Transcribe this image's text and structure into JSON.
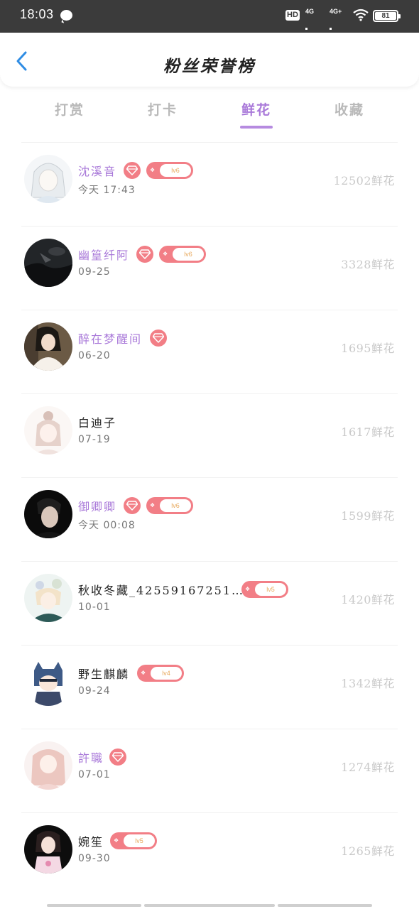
{
  "status_bar": {
    "time": "18:03",
    "hd_label": "HD",
    "sim1_label": "4G",
    "sim2_label": "4G+",
    "battery": "81"
  },
  "header": {
    "title": "粉丝荣誉榜",
    "back_icon": "chevron-left-icon"
  },
  "tabs": [
    {
      "label": "打赏",
      "active": false
    },
    {
      "label": "打卡",
      "active": false
    },
    {
      "label": "鲜花",
      "active": true
    },
    {
      "label": "收藏",
      "active": false
    }
  ],
  "colors": {
    "accent_purple": "#a979d9",
    "badge_pink": "#f27e86",
    "score_gray": "#c9c9c9",
    "level_text": "#e8a95d"
  },
  "fans": [
    {
      "name": "沈溪音",
      "vip": true,
      "diamond": true,
      "level": "lv6",
      "time": "今天  17:43",
      "score": "12502鲜花"
    },
    {
      "name": "幽篁纤阿",
      "vip": true,
      "diamond": true,
      "level": "lv6",
      "time": "09-25",
      "score": "3328鲜花"
    },
    {
      "name": "醉在梦醒间",
      "vip": true,
      "diamond": true,
      "level": "",
      "time": "06-20",
      "score": "1695鲜花"
    },
    {
      "name": "白迪子",
      "vip": false,
      "diamond": false,
      "level": "",
      "time": "07-19",
      "score": "1617鲜花"
    },
    {
      "name": "御卿卿",
      "vip": true,
      "diamond": true,
      "level": "lv6",
      "time": "今天  00:08",
      "score": "1599鲜花"
    },
    {
      "name": "秋收冬藏_42559167251…",
      "vip": false,
      "diamond": false,
      "level": "lv5",
      "time": "10-01",
      "score": "1420鲜花"
    },
    {
      "name": "野生麒麟",
      "vip": false,
      "diamond": false,
      "level": "lv4",
      "time": "09-24",
      "score": "1342鲜花"
    },
    {
      "name": "許職",
      "vip": true,
      "diamond": true,
      "level": "",
      "time": "07-01",
      "score": "1274鲜花"
    },
    {
      "name": "婉笙",
      "vip": false,
      "diamond": false,
      "level": "lv5",
      "time": "09-30",
      "score": "1265鲜花"
    }
  ]
}
